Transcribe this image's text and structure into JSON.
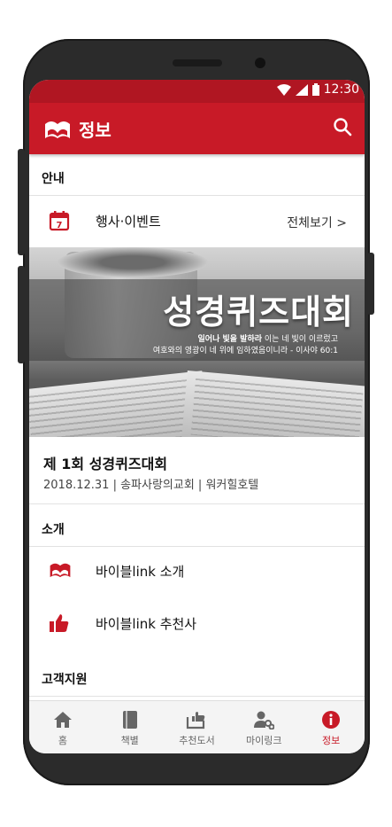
{
  "status": {
    "time": "12:30"
  },
  "appbar": {
    "title": "정보"
  },
  "sections": {
    "guide": "안내",
    "intro": "소개",
    "support": "고객지원"
  },
  "events_row": {
    "label": "행사·이벤트",
    "more": "전체보기 >",
    "calendar_day": "7"
  },
  "banner": {
    "title": "성경퀴즈대회",
    "verse_bold": "일어나 빛을 발하라",
    "verse_rest": " 이는 네 빛이 이르렀고",
    "verse_line2": "여호와의 영광이 네 위에 임하였음이니라 - 이사야 60:1"
  },
  "event": {
    "title": "제 1회 성경퀴즈대회",
    "meta": "2018.12.31  |  송파사랑의교회  |  워커힐호텔"
  },
  "intro_items": [
    {
      "label": "바이블link 소개",
      "icon": "book-logo-icon"
    },
    {
      "label": "바이블link 추천사",
      "icon": "thumbs-up-icon"
    }
  ],
  "tabs": [
    {
      "label": "홈",
      "icon": "home-icon"
    },
    {
      "label": "책별",
      "icon": "book-icon"
    },
    {
      "label": "추천도서",
      "icon": "recommend-books-icon"
    },
    {
      "label": "마이링크",
      "icon": "my-link-icon"
    },
    {
      "label": "정보",
      "icon": "info-icon",
      "active": true
    }
  ],
  "colors": {
    "primary": "#c81a27",
    "status_bar": "#b01622",
    "tab_inactive": "#666666"
  }
}
